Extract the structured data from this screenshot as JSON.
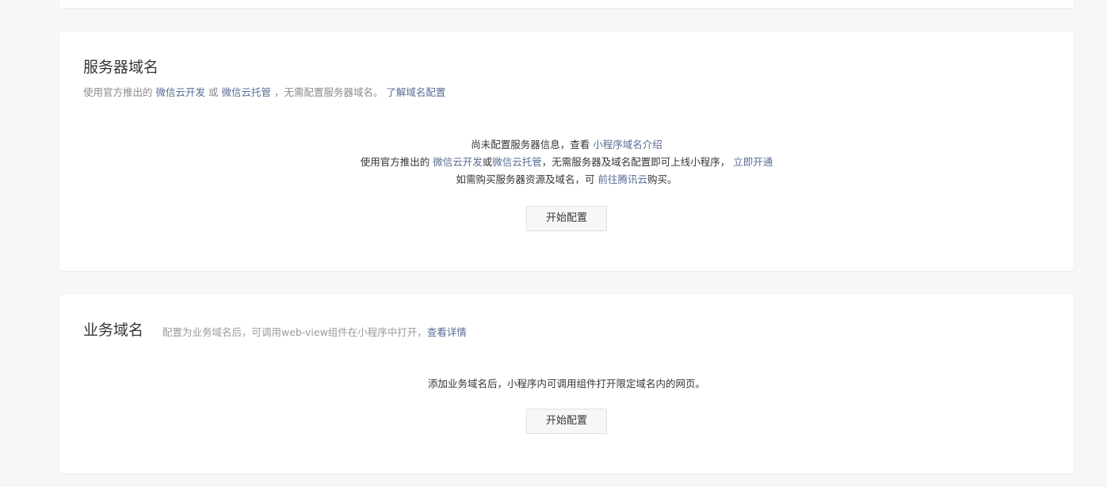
{
  "server_domain": {
    "title": "服务器域名",
    "desc_prefix": "使用官方推出的 ",
    "desc_link_cloud_dev": "微信云开发",
    "desc_or": " 或 ",
    "desc_link_cloud_host": "微信云托管",
    "desc_suffix": " ，无需配置服务器域名。 ",
    "desc_link_learn": "了解域名配置",
    "empty_line1_text": "尚未配置服务器信息，查看 ",
    "empty_line1_link": "小程序域名介绍",
    "empty_line2_prefix": "使用官方推出的 ",
    "empty_line2_link_dev": "微信云开发",
    "empty_line2_or": "或",
    "empty_line2_link_host": "微信云托管",
    "empty_line2_mid": "，无需服务器及域名配置即可上线小程序， ",
    "empty_line2_link_open": "立即开通",
    "empty_line3_prefix": "如需购买服务器资源及域名，可 ",
    "empty_line3_link": "前往腾讯云",
    "empty_line3_suffix": "购买。",
    "button_label": "开始配置"
  },
  "business_domain": {
    "title": "业务域名",
    "desc_text": "配置为业务域名后，可调用web-view组件在小程序中打开，",
    "desc_link": "查看详情",
    "empty_text": "添加业务域名后，小程序内可调用组件打开限定域名内的网页。",
    "button_label": "开始配置"
  },
  "colors": {
    "background": "#f6f7f9",
    "card": "#ffffff",
    "link": "#576b95",
    "text": "#353535",
    "muted": "#8a8a8a"
  }
}
